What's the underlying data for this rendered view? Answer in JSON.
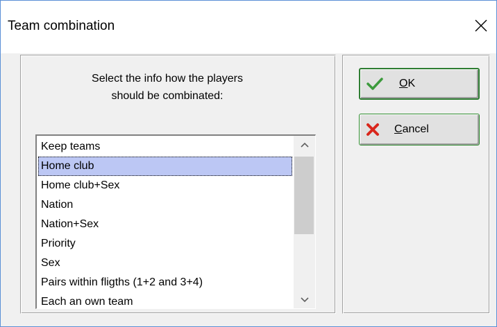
{
  "window": {
    "title": "Team combination"
  },
  "instructions": {
    "line1": "Select the info how the players",
    "line2": "should be combinated:"
  },
  "list": {
    "items": [
      "Keep teams",
      "Home club",
      "Home club+Sex",
      "Nation",
      "Nation+Sex",
      "Priority",
      "Sex",
      "Pairs within fligths (1+2 and 3+4)",
      "Each an own team"
    ],
    "selected": "Home club",
    "selection_color": "#bcc7f4"
  },
  "buttons": {
    "ok_accel": "O",
    "ok_rest": "K",
    "cancel_accel": "C",
    "cancel_rest": "ancel"
  },
  "icons": {
    "ok": "checkmark-icon",
    "cancel": "x-mark-icon",
    "close": "close-icon"
  },
  "colors": {
    "ok_check": "#3c9a3c",
    "cancel_x": "#d9261c"
  }
}
